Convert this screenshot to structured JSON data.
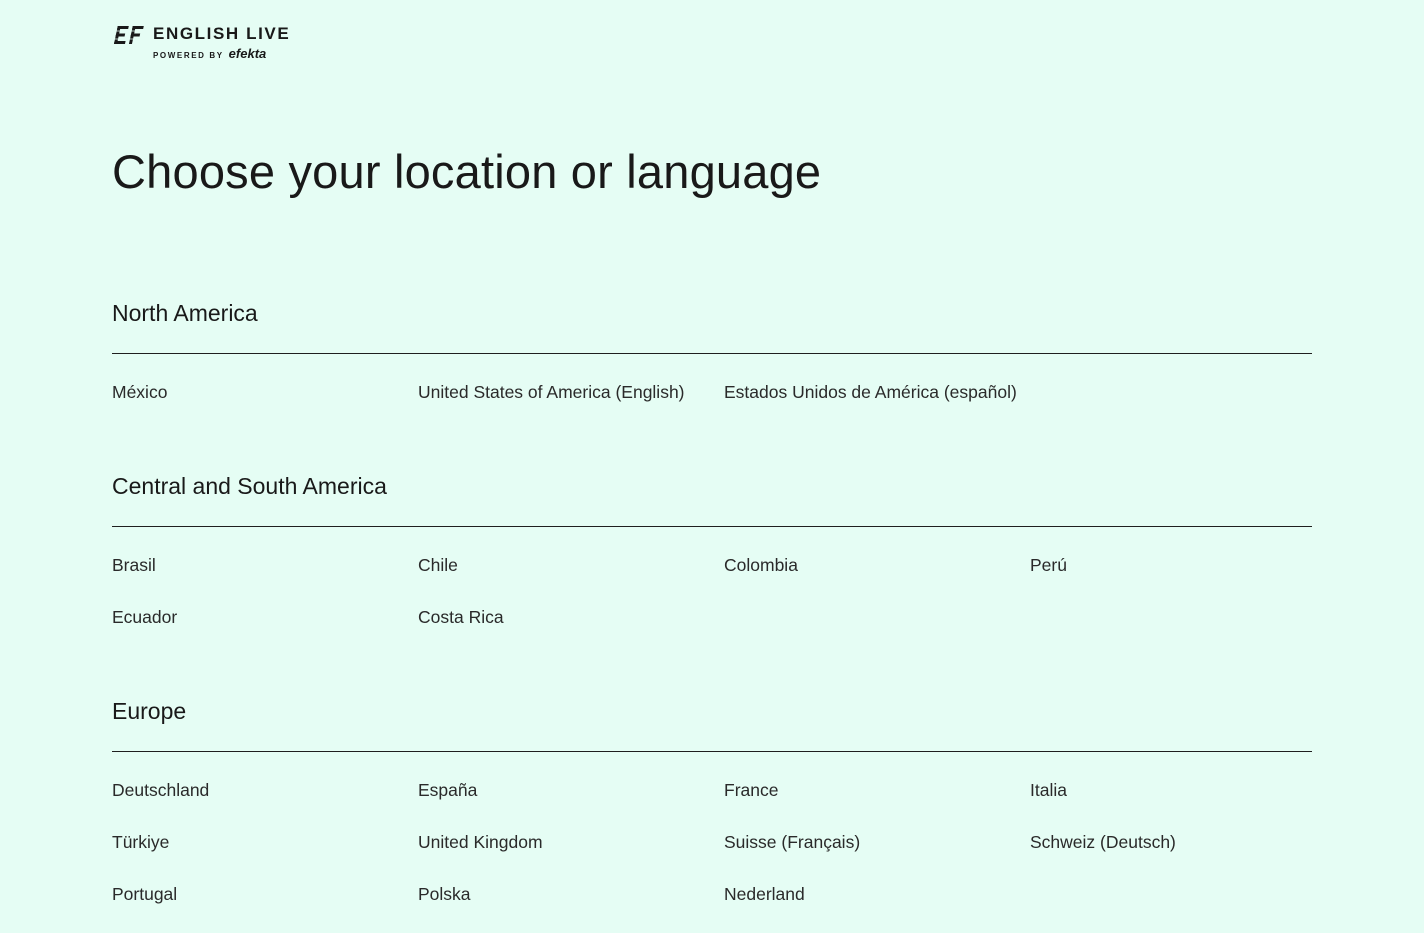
{
  "brand": {
    "title": "ENGLISH LIVE",
    "powered_by": "POWERED BY",
    "partner": "efekta"
  },
  "heading": "Choose your location or language",
  "regions": [
    {
      "title": "North America",
      "links": [
        "México",
        "United States of America (English)",
        "Estados Unidos de América (español)"
      ]
    },
    {
      "title": "Central and South America",
      "links": [
        "Brasil",
        "Chile",
        "Colombia",
        "Perú",
        "Ecuador",
        "Costa Rica"
      ]
    },
    {
      "title": "Europe",
      "links": [
        "Deutschland",
        "España",
        "France",
        "Italia",
        "Türkiye",
        "United Kingdom",
        "Suisse (Français)",
        "Schweiz (Deutsch)",
        "Portugal",
        "Polska",
        "Nederland"
      ]
    }
  ]
}
